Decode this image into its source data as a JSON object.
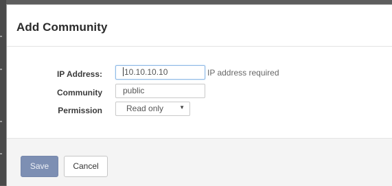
{
  "dialog": {
    "title": "Add Community",
    "fields": {
      "ip_address": {
        "label": "IP Address:",
        "value": "10.10.10.10",
        "hint": "IP address required"
      },
      "community": {
        "label": "Community",
        "value": "public"
      },
      "permission": {
        "label": "Permission",
        "selected": "Read only"
      }
    },
    "footer": {
      "save_label": "Save",
      "cancel_label": "Cancel"
    }
  },
  "colors": {
    "save_button": "#7d8fb3",
    "active_field_border": "#8eb9e6",
    "footer_background": "#f4f4f4",
    "backdrop": "#5e5e5e"
  },
  "icons": {
    "dropdown": "chevron-down-icon"
  }
}
